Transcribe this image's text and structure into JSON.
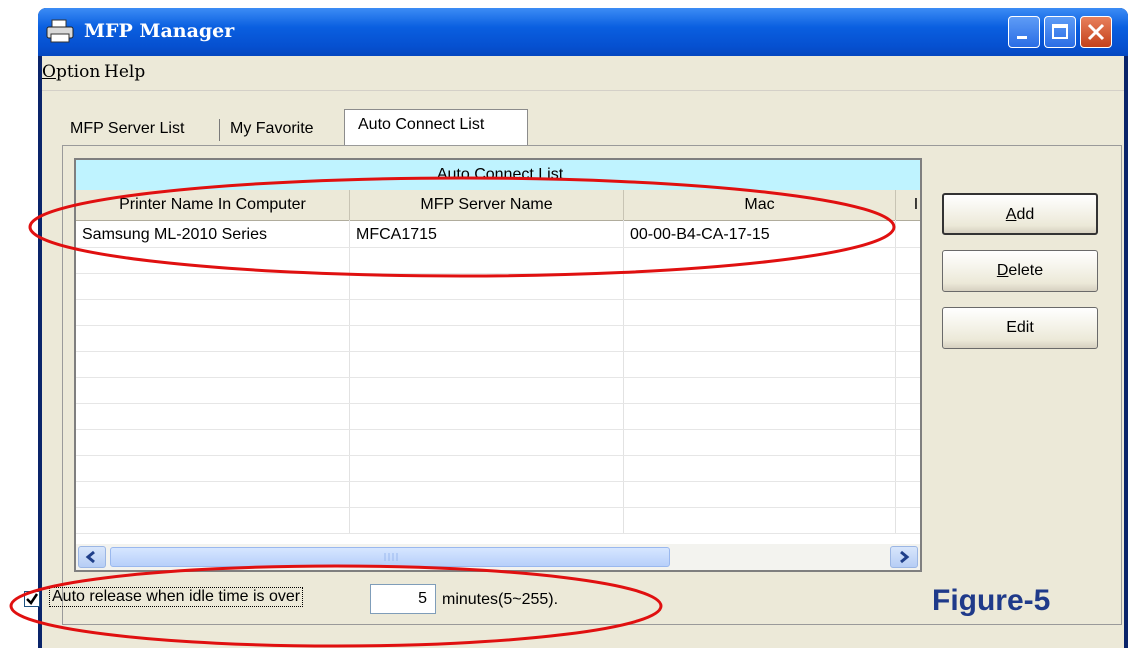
{
  "window": {
    "title": "MFP Manager"
  },
  "menu": {
    "option": "Option",
    "option_rest": "ption",
    "option_key": "O",
    "help": "Help"
  },
  "tabs": [
    {
      "label": "MFP Server List"
    },
    {
      "label": "My Favorite"
    },
    {
      "label": "Auto Connect List"
    }
  ],
  "list": {
    "caption": "Auto Connect List",
    "columns": [
      "Printer Name In Computer",
      "MFP Server Name",
      "Mac",
      "I"
    ],
    "rows": [
      [
        "Samsung ML-2010 Series",
        "MFCA1715",
        "00-00-B4-CA-17-15"
      ]
    ]
  },
  "buttons": {
    "add": "Add",
    "add_key": "A",
    "add_rest": "dd",
    "delete": "Delete",
    "delete_key": "D",
    "delete_rest": "elete",
    "edit": "Edit"
  },
  "footer": {
    "checkbox_checked": true,
    "checkbox_label": "Auto release when idle time is over",
    "idle_minutes": "5",
    "minutes_text": "minutes(5~255)."
  },
  "figure_label": "Figure-5",
  "colors": {
    "annotation_ring": "#e01010",
    "caption_bg": "#bff3ff",
    "title_bar": "#0a5fe0"
  }
}
